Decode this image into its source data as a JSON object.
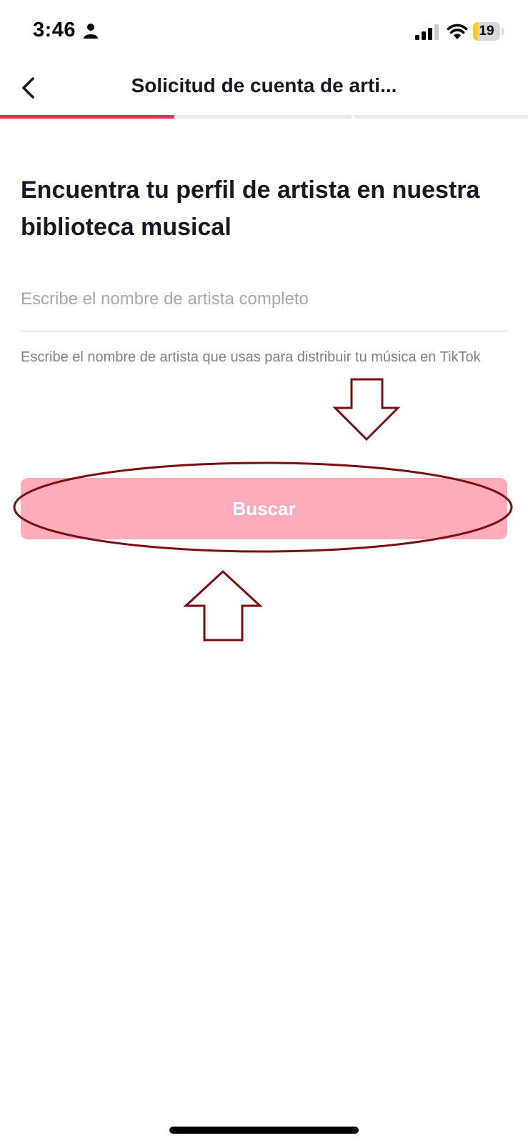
{
  "status_bar": {
    "time": "3:46",
    "battery_level": "19",
    "battery_fraction": 0.19,
    "icons": [
      "person-icon",
      "signal-icon",
      "wifi-icon",
      "battery-icon"
    ]
  },
  "header": {
    "title": "Solicitud de cuenta de arti...",
    "back_icon": "chevron-left-icon"
  },
  "progress": {
    "steps_total": 3,
    "current_step": 1
  },
  "main": {
    "heading": "Encuentra tu perfil de artista en nuestra biblioteca musical",
    "artist_input": {
      "value": "",
      "placeholder": "Escribe el nombre de artista completo"
    },
    "helper_text": "Escribe el nombre de artista que usas para distribuir tu música en TikTok",
    "search_button_label": "Buscar"
  },
  "annotations": {
    "shapes": [
      "down-arrow",
      "highlight-ellipse",
      "up-arrow"
    ]
  },
  "colors": {
    "accent": "#fe2c55",
    "button_disabled": "#feacbb",
    "progress_inactive": "#e8e8e8",
    "annotation": "#7b0d10",
    "battery_fill": "#f7cc27"
  }
}
